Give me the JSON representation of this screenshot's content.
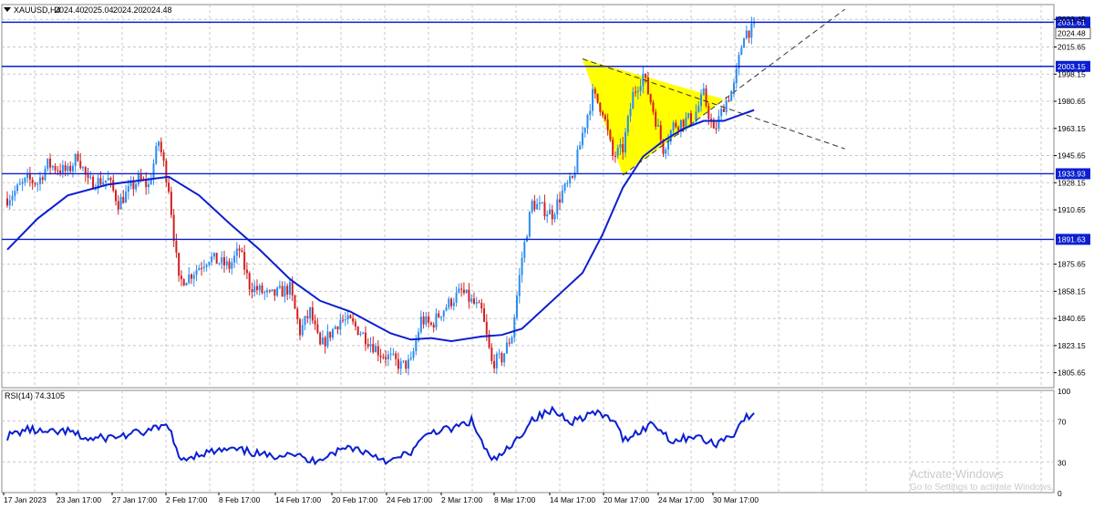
{
  "header": {
    "symbol": "XAUUSD,H4",
    "open": "2024.40",
    "high": "2025.04",
    "low": "2024.20",
    "close": "2024.48"
  },
  "watermark": {
    "title": "Activate Windows",
    "subtitle": "Go to Settings to activate Windows."
  },
  "chart_data": [
    {
      "type": "candlestick",
      "title": "XAUUSD,H4",
      "ylim": [
        1796,
        2043
      ],
      "y_ticks": [
        "2033.45",
        "2015.65",
        "1998.15",
        "1980.65",
        "1963.15",
        "1945.65",
        "1928.15",
        "1910.65",
        "1875.65",
        "1858.15",
        "1840.65",
        "1823.15",
        "1805.65"
      ],
      "x_ticks": [
        "17 Jan 2023",
        "23 Jan 17:00",
        "27 Jan 17:00",
        "2 Feb 17:00",
        "8 Feb 17:00",
        "14 Feb 17:00",
        "20 Feb 17:00",
        "24 Feb 17:00",
        "2 Mar 17:00",
        "8 Mar 17:00",
        "14 Mar 17:00",
        "20 Mar 17:00",
        "24 Mar 17:00",
        "30 Mar 17:00"
      ],
      "current_price": "2024.48",
      "bull_color": "#2a8cf0",
      "bear_color": "#d21f1f",
      "ma_color": "#0a1fd0",
      "horizontal_levels": [
        {
          "value": 2031.61,
          "label": "2031.61"
        },
        {
          "value": 2003.15,
          "label": "2003.15"
        },
        {
          "value": 1933.93,
          "label": "1933.93"
        },
        {
          "value": 1891.63,
          "label": "1891.63"
        }
      ],
      "triangle": {
        "color": "#ffff00",
        "points": [
          {
            "date": "15 Mar",
            "price": 2008
          },
          {
            "date": "19 Mar",
            "price": 1933
          },
          {
            "date": "29 Mar",
            "price": 1982
          }
        ]
      },
      "trendlines": [
        {
          "from": {
            "date": "15 Mar",
            "price": 2008
          },
          "to": {
            "date": "10 Apr",
            "price": 1950
          }
        },
        {
          "from": {
            "date": "19 Mar",
            "price": 1933
          },
          "to": {
            "date": "10 Apr",
            "price": 2040
          }
        }
      ],
      "anchors": [
        {
          "date": "17 Jan",
          "price": 1918
        },
        {
          "date": "19 Jan",
          "price": 1930
        },
        {
          "date": "20 Jan",
          "price": 1928
        },
        {
          "date": "21 Jan",
          "price": 1940
        },
        {
          "date": "23 Jan",
          "price": 1935
        },
        {
          "date": "24 Jan",
          "price": 1946
        },
        {
          "date": "25 Jan",
          "price": 1928
        },
        {
          "date": "27 Jan",
          "price": 1930
        },
        {
          "date": "28 Jan",
          "price": 1915
        },
        {
          "date": "30 Jan",
          "price": 1930
        },
        {
          "date": "31 Jan",
          "price": 1926
        },
        {
          "date": "1 Feb",
          "price": 1955
        },
        {
          "date": "2 Feb",
          "price": 1925
        },
        {
          "date": "3 Feb",
          "price": 1864
        },
        {
          "date": "4 Feb",
          "price": 1868
        },
        {
          "date": "6 Feb",
          "price": 1880
        },
        {
          "date": "8 Feb",
          "price": 1874
        },
        {
          "date": "9 Feb",
          "price": 1885
        },
        {
          "date": "10 Feb",
          "price": 1862
        },
        {
          "date": "12 Feb",
          "price": 1855
        },
        {
          "date": "14 Feb",
          "price": 1860
        },
        {
          "date": "15 Feb",
          "price": 1832
        },
        {
          "date": "16 Feb",
          "price": 1845
        },
        {
          "date": "17 Feb",
          "price": 1822
        },
        {
          "date": "19 Feb",
          "price": 1840
        },
        {
          "date": "20 Feb",
          "price": 1838
        },
        {
          "date": "21 Feb",
          "price": 1832
        },
        {
          "date": "23 Feb",
          "price": 1818
        },
        {
          "date": "24 Feb",
          "price": 1815
        },
        {
          "date": "25 Feb",
          "price": 1810
        },
        {
          "date": "26 Feb",
          "price": 1812
        },
        {
          "date": "27 Feb",
          "price": 1840
        },
        {
          "date": "28 Feb",
          "price": 1836
        },
        {
          "date": "1 Mar",
          "price": 1845
        },
        {
          "date": "2 Mar",
          "price": 1852
        },
        {
          "date": "3 Mar",
          "price": 1858
        },
        {
          "date": "5 Mar",
          "price": 1845
        },
        {
          "date": "6 Mar",
          "price": 1812
        },
        {
          "date": "7 Mar",
          "price": 1815
        },
        {
          "date": "8 Mar",
          "price": 1830
        },
        {
          "date": "9 Mar",
          "price": 1880
        },
        {
          "date": "10 Mar",
          "price": 1915
        },
        {
          "date": "12 Mar",
          "price": 1908
        },
        {
          "date": "13 Mar",
          "price": 1922
        },
        {
          "date": "14 Mar",
          "price": 1930
        },
        {
          "date": "15 Mar",
          "price": 1960
        },
        {
          "date": "16 Mar",
          "price": 1985
        },
        {
          "date": "17 Mar",
          "price": 1975
        },
        {
          "date": "18 Mar",
          "price": 1945
        },
        {
          "date": "19 Mar",
          "price": 1950
        },
        {
          "date": "20 Mar",
          "price": 1985
        },
        {
          "date": "21 Mar",
          "price": 1998
        },
        {
          "date": "22 Mar",
          "price": 1975
        },
        {
          "date": "23 Mar",
          "price": 1950
        },
        {
          "date": "24 Mar",
          "price": 1965
        },
        {
          "date": "25 Mar",
          "price": 1968
        },
        {
          "date": "26 Mar",
          "price": 1970
        },
        {
          "date": "27 Mar",
          "price": 1985
        },
        {
          "date": "28 Mar",
          "price": 1960
        },
        {
          "date": "29 Mar",
          "price": 1978
        },
        {
          "date": "30 Mar",
          "price": 1990
        },
        {
          "date": "31 Mar",
          "price": 2025
        },
        {
          "date": "1 Apr",
          "price": 2027
        }
      ],
      "ma_points": [
        {
          "date": "17 Jan",
          "price": 1885
        },
        {
          "date": "20 Jan",
          "price": 1905
        },
        {
          "date": "23 Jan",
          "price": 1920
        },
        {
          "date": "27 Jan",
          "price": 1927
        },
        {
          "date": "2 Feb",
          "price": 1932
        },
        {
          "date": "5 Feb",
          "price": 1920
        },
        {
          "date": "8 Feb",
          "price": 1902
        },
        {
          "date": "11 Feb",
          "price": 1885
        },
        {
          "date": "14 Feb",
          "price": 1866
        },
        {
          "date": "17 Feb",
          "price": 1852
        },
        {
          "date": "20 Feb",
          "price": 1845
        },
        {
          "date": "22 Feb",
          "price": 1838
        },
        {
          "date": "24 Feb",
          "price": 1831
        },
        {
          "date": "26 Feb",
          "price": 1827
        },
        {
          "date": "28 Feb",
          "price": 1828
        },
        {
          "date": "2 Mar",
          "price": 1826
        },
        {
          "date": "5 Mar",
          "price": 1829
        },
        {
          "date": "7 Mar",
          "price": 1830
        },
        {
          "date": "9 Mar",
          "price": 1834
        },
        {
          "date": "11 Mar",
          "price": 1846
        },
        {
          "date": "13 Mar",
          "price": 1858
        },
        {
          "date": "15 Mar",
          "price": 1870
        },
        {
          "date": "17 Mar",
          "price": 1895
        },
        {
          "date": "19 Mar",
          "price": 1925
        },
        {
          "date": "21 Mar",
          "price": 1945
        },
        {
          "date": "23 Mar",
          "price": 1955
        },
        {
          "date": "25 Mar",
          "price": 1963
        },
        {
          "date": "27 Mar",
          "price": 1968
        },
        {
          "date": "29 Mar",
          "price": 1968
        },
        {
          "date": "1 Apr",
          "price": 1975
        }
      ]
    },
    {
      "type": "line",
      "title": "RSI(14) 74.3105",
      "ylim": [
        0,
        100
      ],
      "y_ticks": [
        "100",
        "70",
        "30",
        "0"
      ],
      "levels": [
        70,
        30
      ],
      "series": [
        {
          "color": "#0a1fd0",
          "points": [
            {
              "date": "17 Jan",
              "value": 55
            },
            {
              "date": "19 Jan",
              "value": 62
            },
            {
              "date": "21 Jan",
              "value": 58
            },
            {
              "date": "23 Jan",
              "value": 60
            },
            {
              "date": "25 Jan",
              "value": 52
            },
            {
              "date": "28 Jan",
              "value": 55
            },
            {
              "date": "31 Jan",
              "value": 60
            },
            {
              "date": "2 Feb",
              "value": 66
            },
            {
              "date": "3 Feb",
              "value": 32
            },
            {
              "date": "5 Feb",
              "value": 38
            },
            {
              "date": "8 Feb",
              "value": 42
            },
            {
              "date": "10 Feb",
              "value": 40
            },
            {
              "date": "12 Feb",
              "value": 35
            },
            {
              "date": "14 Feb",
              "value": 40
            },
            {
              "date": "16 Feb",
              "value": 30
            },
            {
              "date": "18 Feb",
              "value": 38
            },
            {
              "date": "20 Feb",
              "value": 45
            },
            {
              "date": "22 Feb",
              "value": 38
            },
            {
              "date": "24 Feb",
              "value": 30
            },
            {
              "date": "26 Feb",
              "value": 40
            },
            {
              "date": "28 Feb",
              "value": 60
            },
            {
              "date": "2 Mar",
              "value": 62
            },
            {
              "date": "4 Mar",
              "value": 70
            },
            {
              "date": "6 Mar",
              "value": 30
            },
            {
              "date": "8 Mar",
              "value": 45
            },
            {
              "date": "10 Mar",
              "value": 72
            },
            {
              "date": "12 Mar",
              "value": 80
            },
            {
              "date": "14 Mar",
              "value": 70
            },
            {
              "date": "16 Mar",
              "value": 78
            },
            {
              "date": "18 Mar",
              "value": 72
            },
            {
              "date": "19 Mar",
              "value": 52
            },
            {
              "date": "21 Mar",
              "value": 62
            },
            {
              "date": "22 Mar",
              "value": 68
            },
            {
              "date": "24 Mar",
              "value": 50
            },
            {
              "date": "26 Mar",
              "value": 56
            },
            {
              "date": "28 Mar",
              "value": 47
            },
            {
              "date": "30 Mar",
              "value": 58
            },
            {
              "date": "31 Mar",
              "value": 73
            },
            {
              "date": "1 Apr",
              "value": 74.31
            }
          ]
        }
      ]
    }
  ]
}
